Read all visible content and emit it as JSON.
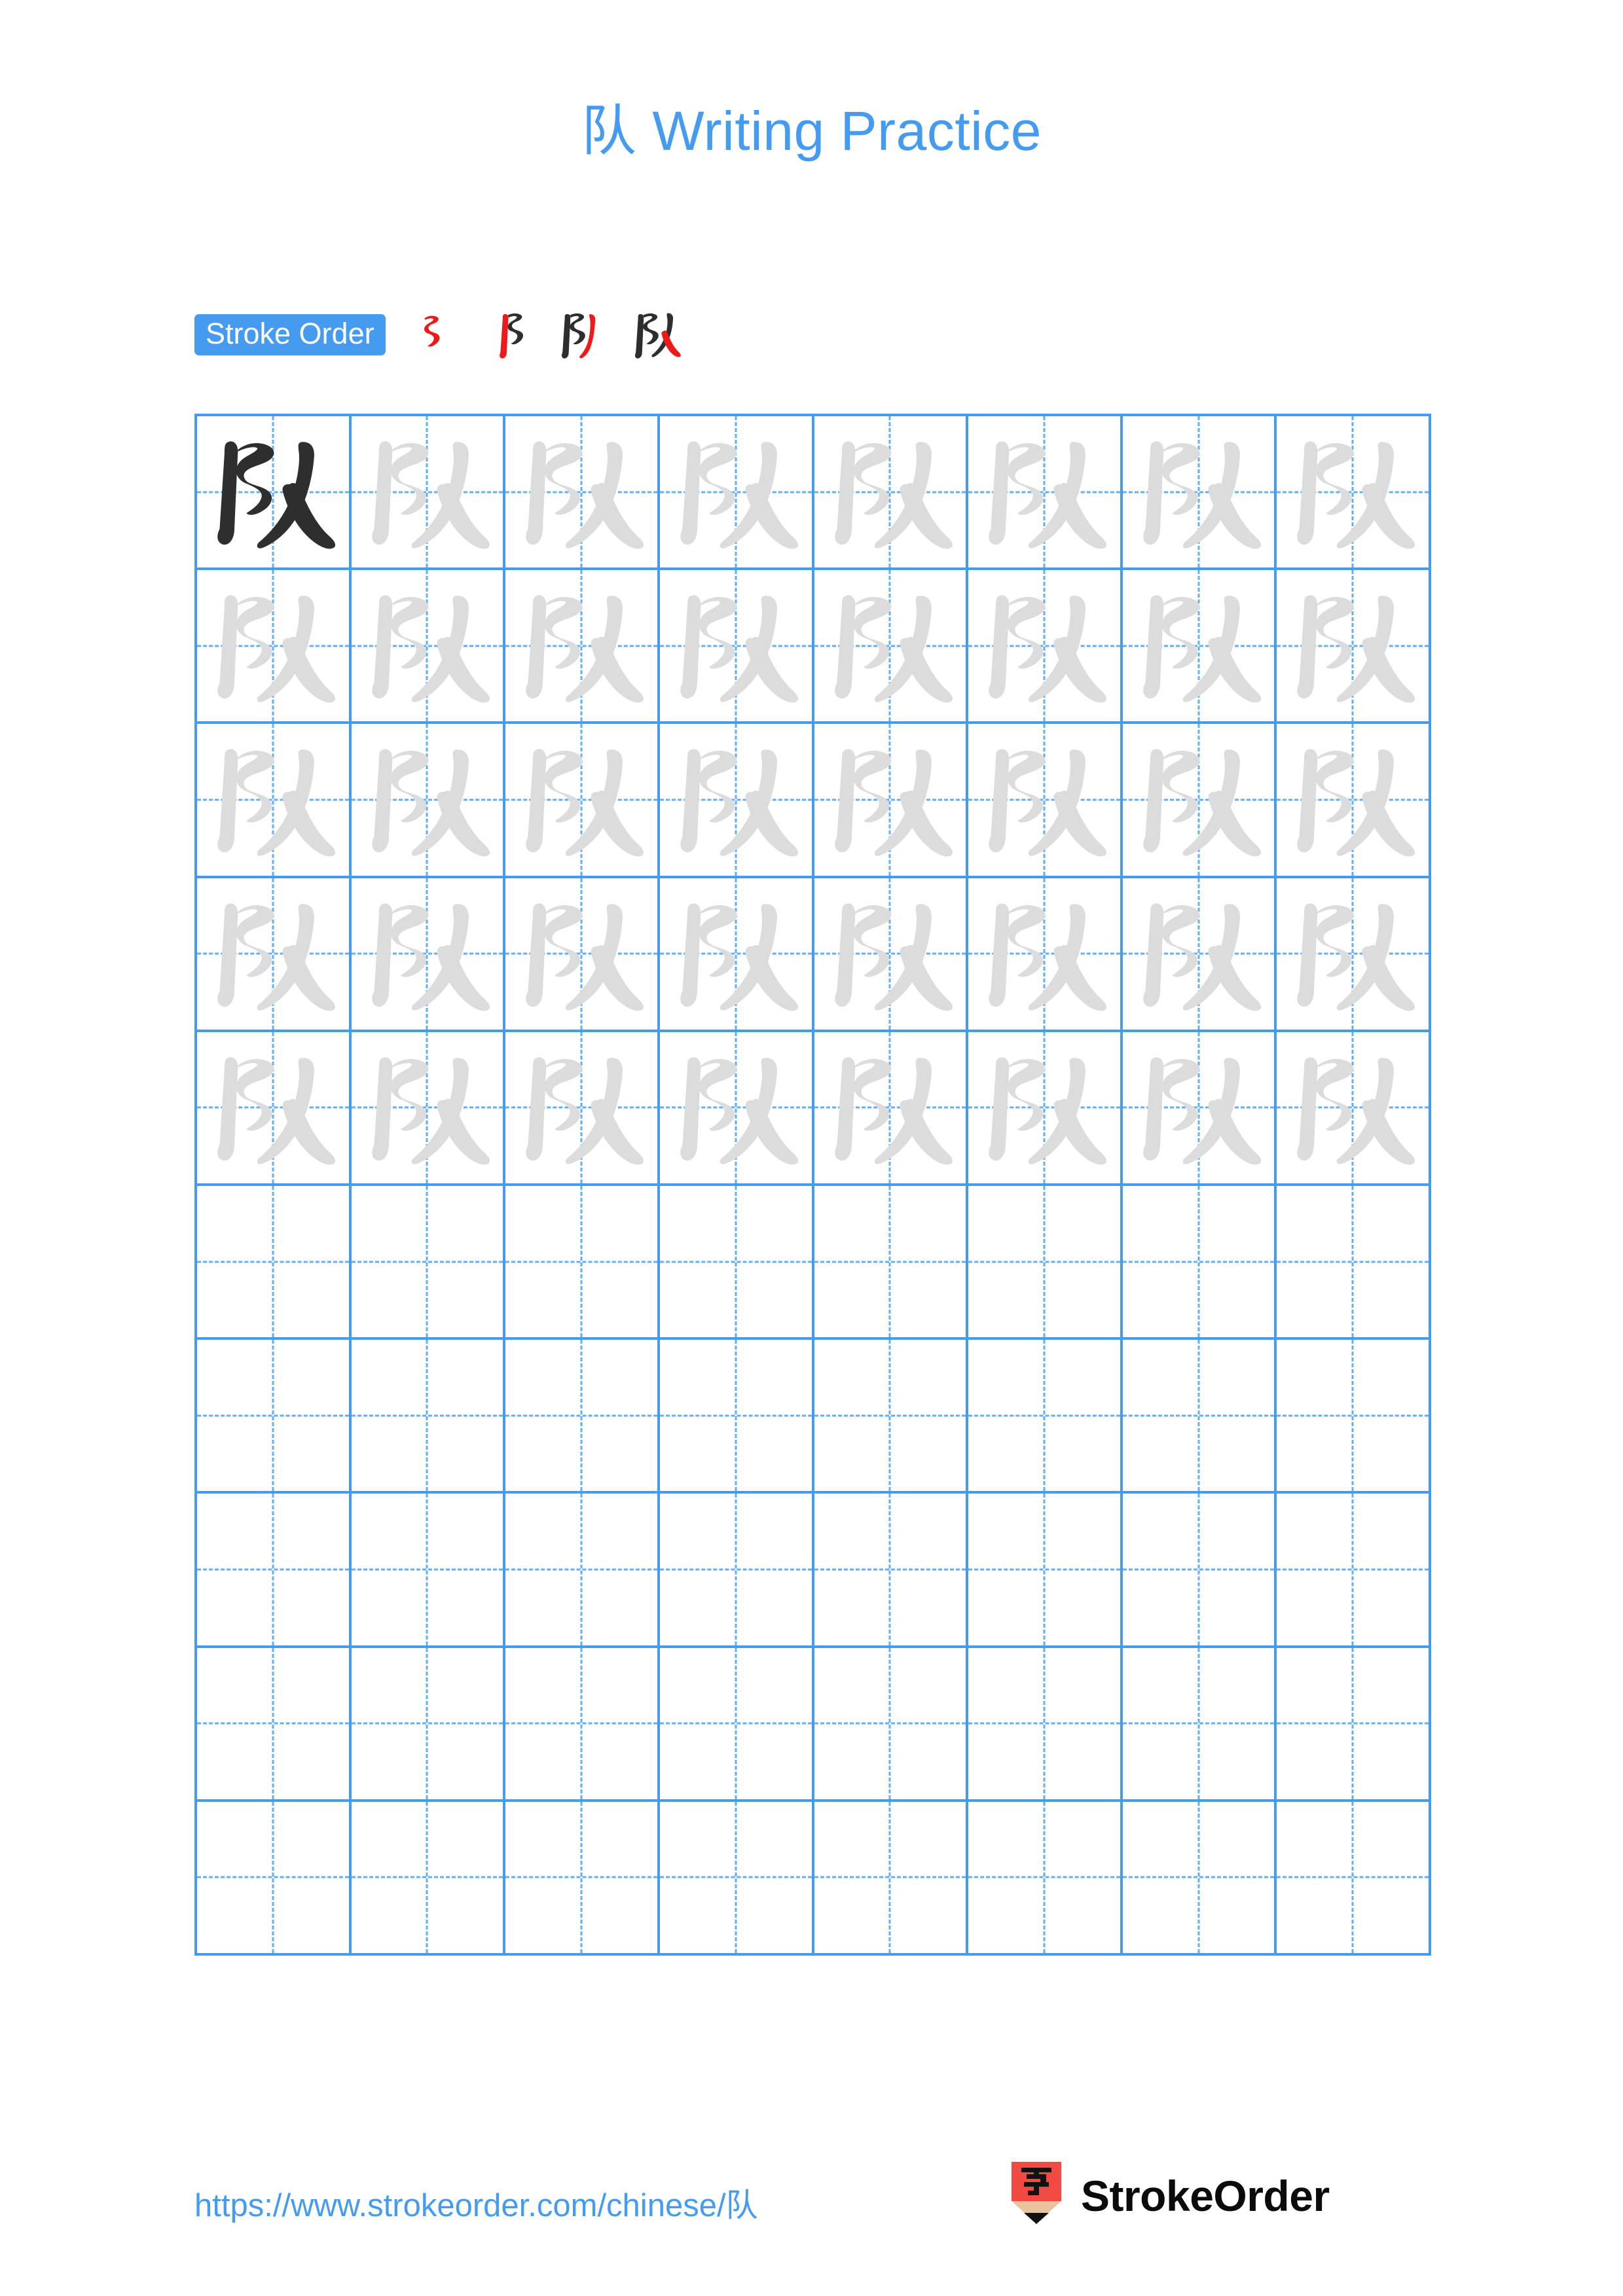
{
  "page": {
    "character": "队",
    "title": "队 Writing Practice",
    "background_color": "#ffffff",
    "accent_color": "#459BEF",
    "trace_color": "#DCDCDC",
    "ink_color": "#2E2E2E",
    "highlight_stroke_color": "#EE1A1A"
  },
  "stroke_order": {
    "badge_label": "Stroke Order",
    "stroke_count": 4,
    "steps": [
      {
        "index": 1,
        "partial": "陁",
        "new_stroke": "㇀"
      },
      {
        "index": 2,
        "partial": "队",
        "new_stroke": "㇁"
      },
      {
        "index": 3,
        "partial": "队",
        "new_stroke": "㇂"
      },
      {
        "index": 4,
        "partial": "队",
        "new_stroke": "㇃"
      }
    ]
  },
  "grid": {
    "columns": 8,
    "rows": 10,
    "guide_style": "dashed-cross",
    "border_color": "#459BEF",
    "guide_color": "#64AEF5",
    "rows_data": [
      [
        "ink",
        "trace",
        "trace",
        "trace",
        "trace",
        "trace",
        "trace",
        "trace"
      ],
      [
        "trace",
        "trace",
        "trace",
        "trace",
        "trace",
        "trace",
        "trace",
        "trace"
      ],
      [
        "trace",
        "trace",
        "trace",
        "trace",
        "trace",
        "trace",
        "trace",
        "trace"
      ],
      [
        "trace",
        "trace",
        "trace",
        "trace",
        "trace",
        "trace",
        "trace",
        "trace"
      ],
      [
        "trace",
        "trace",
        "trace",
        "trace",
        "trace",
        "trace",
        "trace",
        "trace"
      ],
      [
        "empty",
        "empty",
        "empty",
        "empty",
        "empty",
        "empty",
        "empty",
        "empty"
      ],
      [
        "empty",
        "empty",
        "empty",
        "empty",
        "empty",
        "empty",
        "empty",
        "empty"
      ],
      [
        "empty",
        "empty",
        "empty",
        "empty",
        "empty",
        "empty",
        "empty",
        "empty"
      ],
      [
        "empty",
        "empty",
        "empty",
        "empty",
        "empty",
        "empty",
        "empty",
        "empty"
      ],
      [
        "empty",
        "empty",
        "empty",
        "empty",
        "empty",
        "empty",
        "empty",
        "empty"
      ]
    ]
  },
  "footer": {
    "url": "https://www.strokeorder.com/chinese/队",
    "brand_name": "StrokeOrder",
    "logo": {
      "icon_character": "字",
      "body_color": "#F04A43",
      "wood_color": "#E8C39E",
      "tip_color": "#111111"
    }
  }
}
